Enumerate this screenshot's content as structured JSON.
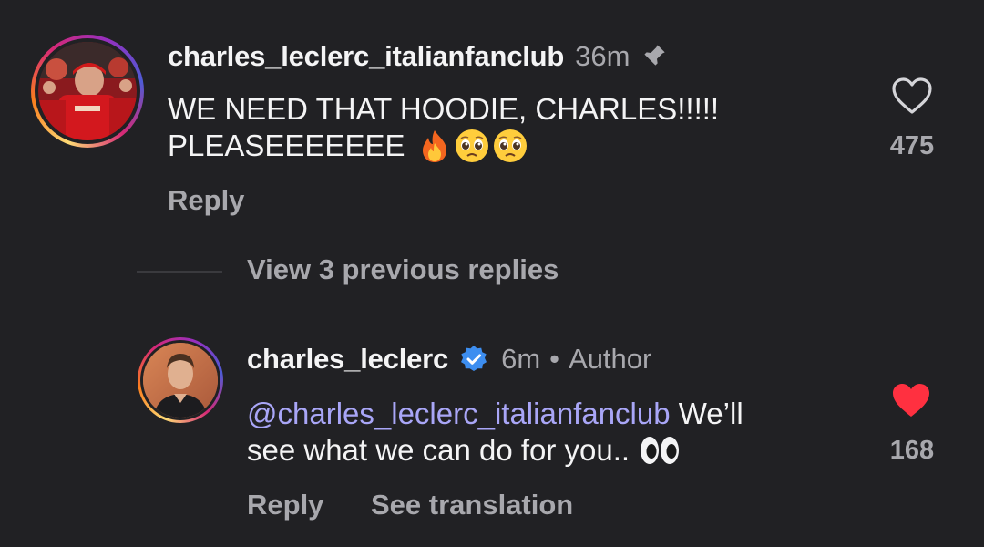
{
  "parent_comment": {
    "username": "charles_leclerc_italianfanclub",
    "time": "36m",
    "text_line1": "WE NEED THAT HOODIE, CHARLES!!!!!",
    "text_line2": "PLEASEEEEEEE",
    "reply_label": "Reply",
    "like_count": "475",
    "icons": [
      "pin-icon",
      "heart-outline-icon",
      "fire-emoji",
      "pleading-face-emoji",
      "pleading-face-emoji"
    ]
  },
  "view_replies": {
    "label": "View 3 previous replies"
  },
  "reply_comment": {
    "username": "charles_leclerc",
    "time": "6m",
    "separator": "•",
    "author_label": "Author",
    "mention": "@charles_leclerc_italianfanclub",
    "text_after_mention": " We’ll",
    "text_line2": "see what we can do for you..",
    "reply_label": "Reply",
    "translation_label": "See translation",
    "like_count": "168",
    "icons": [
      "verified-badge-icon",
      "heart-filled-icon",
      "eyes-emoji"
    ]
  },
  "colors": {
    "background": "#212124",
    "text_primary": "#f4f4f5",
    "text_secondary": "#a8a8ad",
    "mention": "#a9a6f7",
    "liked_heart": "#ff3040",
    "verified": "#3d8ef0"
  }
}
